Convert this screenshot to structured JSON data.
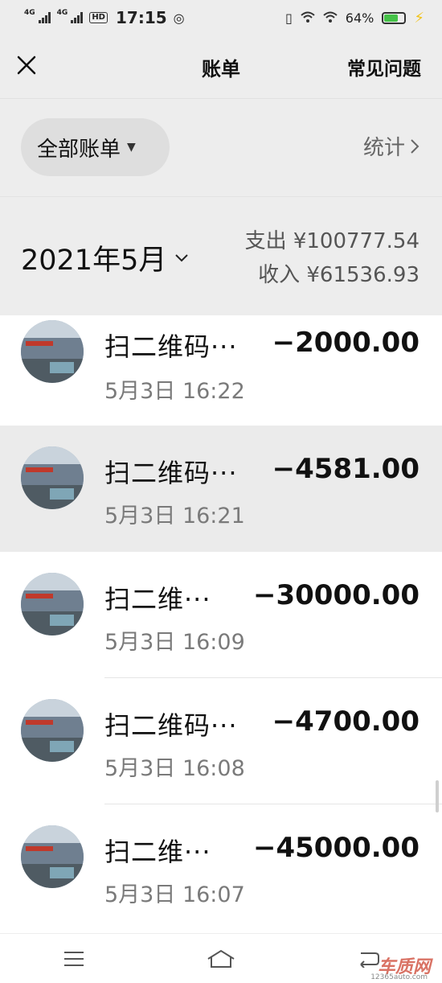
{
  "status_bar": {
    "network1": "4G",
    "network2": "4G",
    "hd_label": "HD",
    "time": "17:15",
    "battery": "64%"
  },
  "header": {
    "title": "账单",
    "faq": "常见问题"
  },
  "filter": {
    "label": "全部账单",
    "stats": "统计"
  },
  "month": {
    "label": "2021年5月",
    "expense": "支出 ¥100777.54",
    "income": "收入 ¥61536.93"
  },
  "transactions": [
    {
      "name": "扫二维码···",
      "amount": "−2000.00",
      "time": "5月3日 16:22"
    },
    {
      "name": "扫二维码···",
      "amount": "−4581.00",
      "time": "5月3日 16:21"
    },
    {
      "name": "扫二维···",
      "amount": "−30000.00",
      "time": "5月3日 16:09"
    },
    {
      "name": "扫二维码···",
      "amount": "−4700.00",
      "time": "5月3日 16:08"
    },
    {
      "name": "扫二维···",
      "amount": "−45000.00",
      "time": "5月3日 16:07"
    }
  ],
  "watermark": {
    "logo": "车质网",
    "url": "12365auto.com"
  },
  "colors": {
    "header_bg": "#ededed",
    "selected_row": "#ebebeb",
    "battery": "#45c248"
  },
  "icons": [
    "close-icon",
    "caret-down-icon",
    "chevron-right-icon",
    "chevron-down-icon",
    "menu-icon",
    "home-icon",
    "back-icon"
  ]
}
